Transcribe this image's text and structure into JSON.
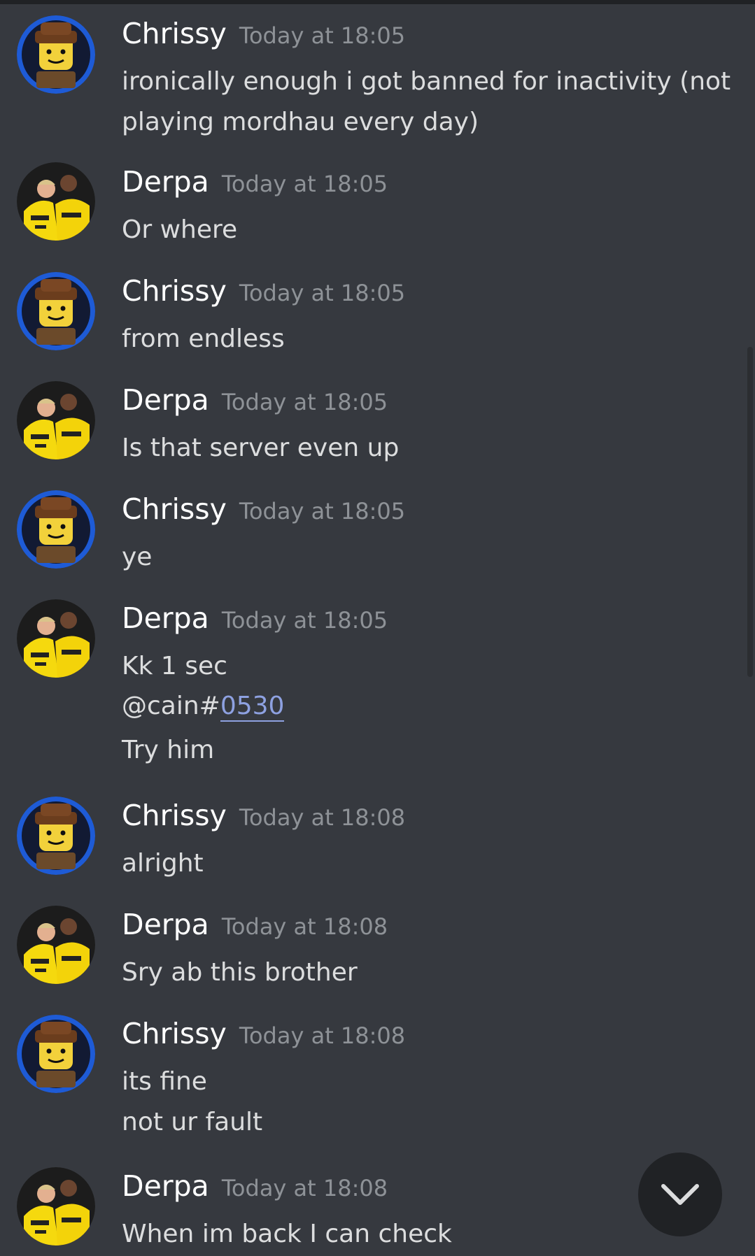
{
  "messages": [
    {
      "author": "Chrissy",
      "time": "Today at 18:05",
      "lines": [
        "ironically enough i got banned for inactivity (not",
        "playing mordhau every day)"
      ],
      "avatar": "lego-minifig-avatar"
    },
    {
      "author": "Derpa",
      "time": "Today at 18:05",
      "lines": [
        "Or where"
      ],
      "avatar": "football-players-avatar"
    },
    {
      "author": "Chrissy",
      "time": "Today at 18:05",
      "lines": [
        "from endless"
      ],
      "avatar": "lego-minifig-avatar"
    },
    {
      "author": "Derpa",
      "time": "Today at 18:05",
      "lines": [
        "Is that server even up"
      ],
      "avatar": "football-players-avatar"
    },
    {
      "author": "Chrissy",
      "time": "Today at 18:05",
      "lines": [
        "ye"
      ],
      "avatar": "lego-minifig-avatar"
    },
    {
      "author": "Derpa",
      "time": "Today at 18:05",
      "lines": [
        "Kk 1 sec",
        "",
        "Try him"
      ],
      "mention": {
        "prefix": "@cain#",
        "link": "0530"
      },
      "avatar": "football-players-avatar"
    },
    {
      "author": "Chrissy",
      "time": "Today at 18:08",
      "lines": [
        "alright"
      ],
      "avatar": "lego-minifig-avatar"
    },
    {
      "author": "Derpa",
      "time": "Today at 18:08",
      "lines": [
        "Sry ab this brother"
      ],
      "avatar": "football-players-avatar"
    },
    {
      "author": "Chrissy",
      "time": "Today at 18:08",
      "lines": [
        "its fine",
        "not ur fault"
      ],
      "avatar": "lego-minifig-avatar"
    },
    {
      "author": "Derpa",
      "time": "Today at 18:08",
      "lines": [
        "When im back I can check"
      ],
      "avatar": "football-players-avatar"
    }
  ],
  "jump_button": {
    "icon": "chevron-down-icon"
  },
  "colors": {
    "background": "#36393f",
    "author": "#ffffff",
    "timestamp": "#8e9297",
    "text": "#dcddde",
    "link": "#8ea1e1",
    "avatar_ring": "#1e5bd6"
  }
}
